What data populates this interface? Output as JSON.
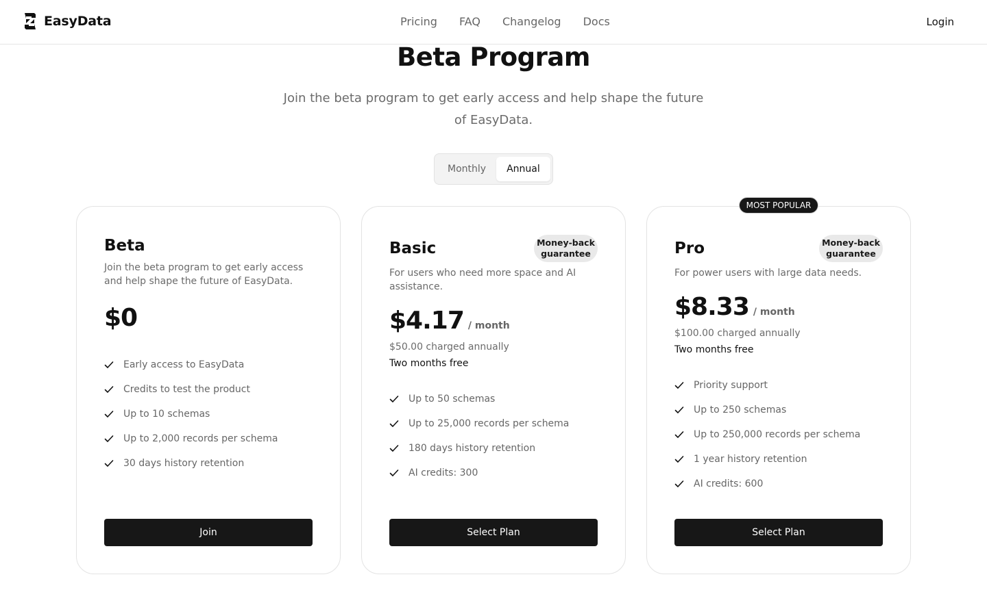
{
  "header": {
    "brand": "EasyData",
    "nav": [
      "Pricing",
      "FAQ",
      "Changelog",
      "Docs"
    ],
    "login": "Login"
  },
  "hero": {
    "title": "Beta Program",
    "subtitle": "Join the beta program to get early access and help shape the future of EasyData."
  },
  "billing_toggle": {
    "options": [
      "Monthly",
      "Annual"
    ],
    "selected": "Annual"
  },
  "plans": [
    {
      "name": "Beta",
      "description": "Join the beta program to get early access and help shape the future of EasyData.",
      "price": "$0",
      "features": [
        "Early access to EasyData",
        "Credits to test the product",
        "Up to 10 schemas",
        "Up to 2,000 records per schema",
        "30 days history retention"
      ],
      "cta": "Join"
    },
    {
      "name": "Basic",
      "badge": "Money-back guarantee",
      "description": "For users who need more space and AI assistance.",
      "price": "$4.17",
      "period": "/ month",
      "charged": "$50.00 charged annually",
      "promo": "Two months free",
      "features": [
        "Up to 50 schemas",
        "Up to 25,000 records per schema",
        "180 days history retention",
        "AI credits: 300"
      ],
      "cta": "Select Plan"
    },
    {
      "name": "Pro",
      "ribbon": "MOST POPULAR",
      "badge": "Money-back guarantee",
      "description": "For power users with large data needs.",
      "price": "$8.33",
      "period": "/ month",
      "charged": "$100.00 charged annually",
      "promo": "Two months free",
      "features": [
        "Priority support",
        "Up to 250 schemas",
        "Up to 250,000 records per schema",
        "1 year history retention",
        "AI credits: 600"
      ],
      "cta": "Select Plan"
    }
  ]
}
